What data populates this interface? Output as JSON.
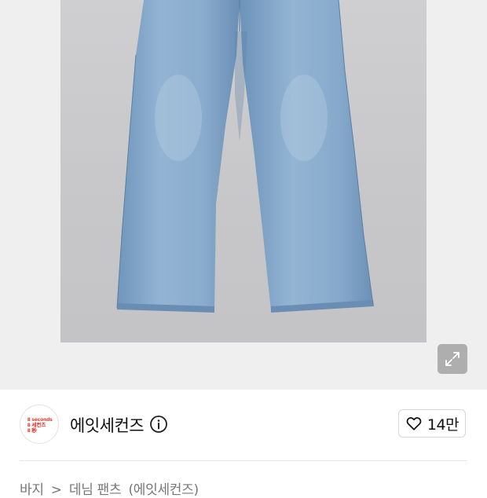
{
  "product": {
    "image_alt": "light blue wide-leg denim jeans"
  },
  "icons": {
    "expand": "expand-arrows-icon",
    "info": "info-circle-icon",
    "like": "heart-outline-icon"
  },
  "brand": {
    "name": "에잇세컨즈",
    "logo_lines": [
      "8 seconds",
      "8 세컨즈",
      "8 秒"
    ],
    "logo_color": "#e2231a"
  },
  "like": {
    "count": "14만"
  },
  "category": {
    "items": [
      "바지",
      ">",
      "데님 팬츠",
      "(에잇세컨즈)"
    ]
  }
}
